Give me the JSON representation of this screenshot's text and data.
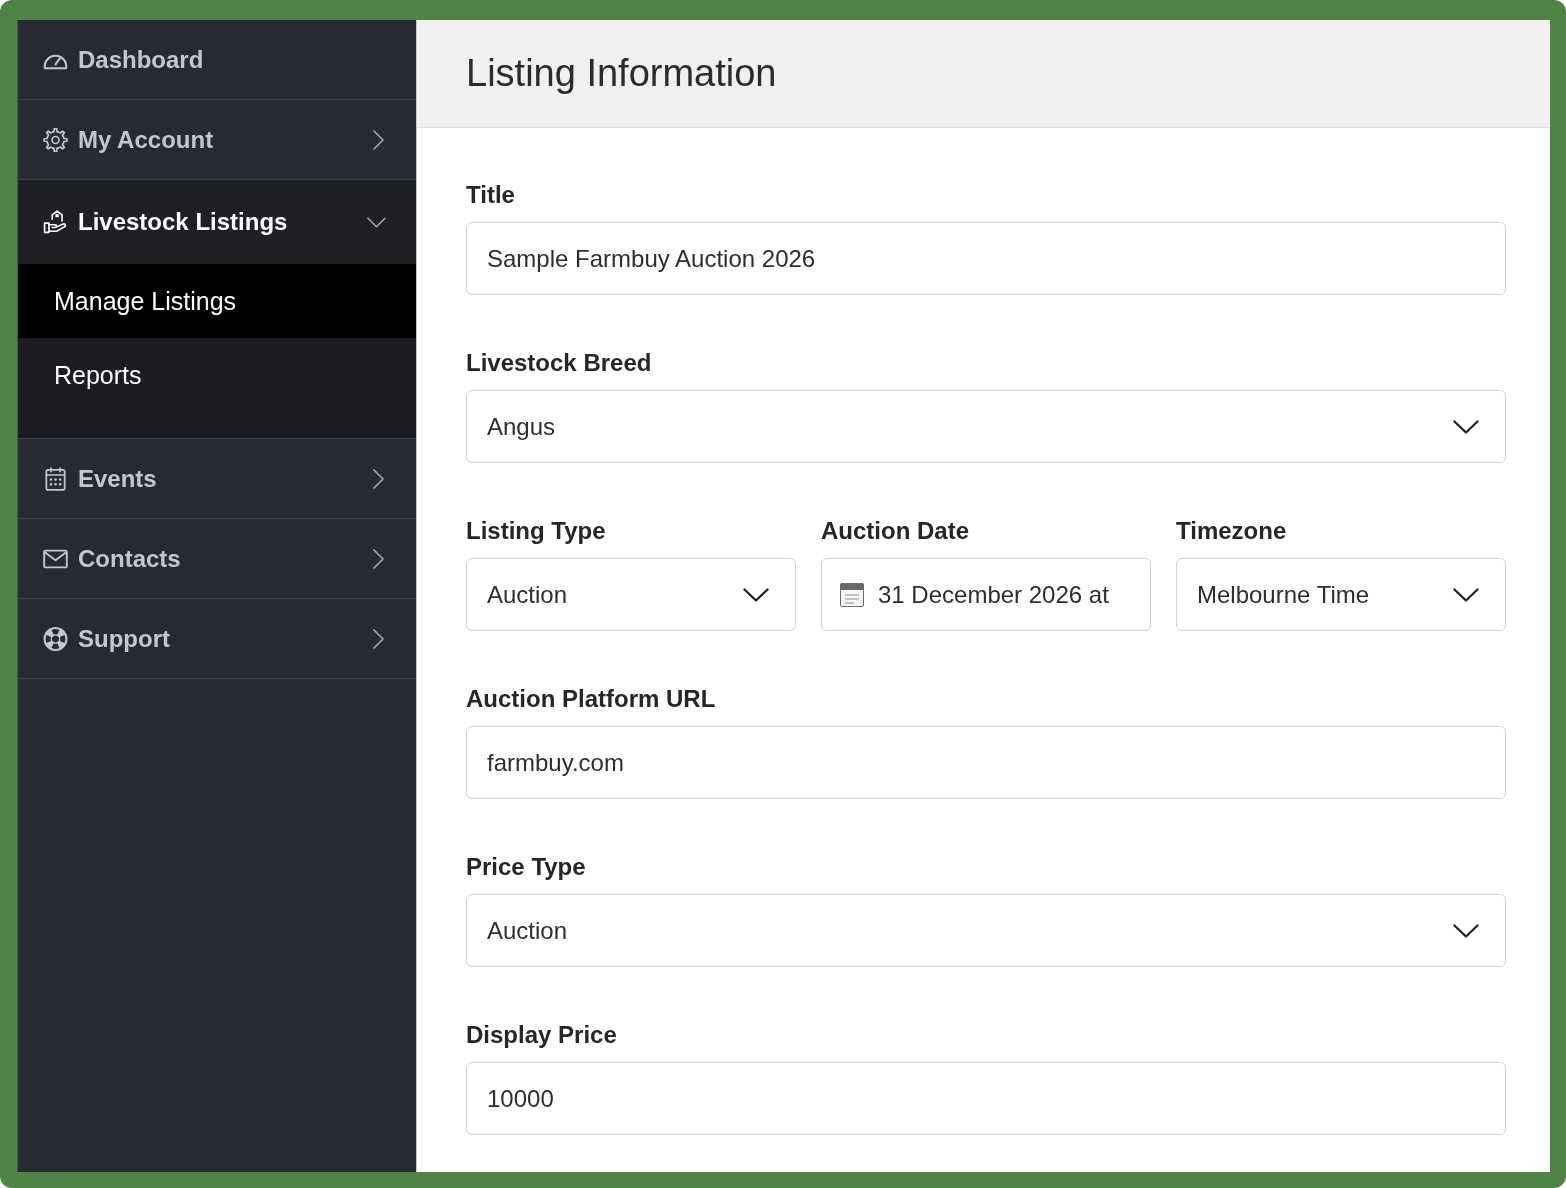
{
  "sidebar": {
    "items": [
      {
        "label": "Dashboard",
        "kind": "link"
      },
      {
        "label": "My Account",
        "kind": "menu",
        "expanded": false
      },
      {
        "label": "Livestock Listings",
        "kind": "menu",
        "expanded": true,
        "children": [
          {
            "label": "Manage Listings",
            "selected": true
          },
          {
            "label": "Reports",
            "selected": false
          }
        ]
      },
      {
        "label": "Events",
        "kind": "menu",
        "expanded": false
      },
      {
        "label": "Contacts",
        "kind": "menu",
        "expanded": false
      },
      {
        "label": "Support",
        "kind": "menu",
        "expanded": false
      }
    ]
  },
  "page_header": {
    "title": "Listing Information"
  },
  "form": {
    "rows": [
      {
        "fields": [
          {
            "label": "Title",
            "kind": "text",
            "value": "Sample Farmbuy Auction 2026"
          }
        ]
      },
      {
        "fields": [
          {
            "label": "Livestock Breed",
            "kind": "select",
            "value": "Angus"
          }
        ]
      },
      {
        "fields": [
          {
            "label": "Listing Type",
            "kind": "select",
            "value": "Auction"
          },
          {
            "label": "Auction Date",
            "kind": "date",
            "value": "31 December 2026 at"
          },
          {
            "label": "Timezone",
            "kind": "select",
            "value": "Melbourne Time"
          }
        ]
      },
      {
        "fields": [
          {
            "label": "Auction Platform URL",
            "kind": "text",
            "value": "farmbuy.com"
          }
        ]
      },
      {
        "fields": [
          {
            "label": "Price Type",
            "kind": "select",
            "value": "Auction"
          }
        ]
      },
      {
        "fields": [
          {
            "label": "Display Price",
            "kind": "text",
            "value": "10000"
          }
        ]
      }
    ]
  }
}
